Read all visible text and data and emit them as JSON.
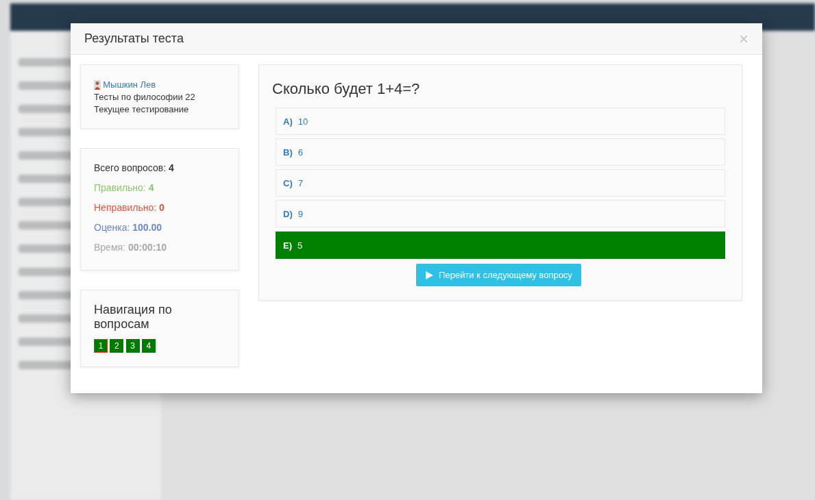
{
  "modal": {
    "title": "Результаты теста",
    "close": "×"
  },
  "student": {
    "name": "Мышкин Лев",
    "test": "Тесты по философии 22",
    "mode": "Текущее тестирование"
  },
  "stats": [
    {
      "kind": "total",
      "label": "Всего вопросов:",
      "value": "4"
    },
    {
      "kind": "correct",
      "label": "Правильно:",
      "value": "4"
    },
    {
      "kind": "wrong",
      "label": "Неправильно:",
      "value": "0"
    },
    {
      "kind": "score",
      "label": "Оценка:",
      "value": "100.00"
    },
    {
      "kind": "time",
      "label": "Время:",
      "value": "00:00:10"
    }
  ],
  "navigation": {
    "title": "Навигация по вопросам",
    "questions": [
      {
        "label": "1",
        "selected": true,
        "answered": true
      },
      {
        "label": "2",
        "selected": false,
        "answered": true
      },
      {
        "label": "3",
        "selected": false,
        "answered": true
      },
      {
        "label": "4",
        "selected": false,
        "answered": true
      }
    ]
  },
  "question": {
    "text": "Сколько будет 1+4=?",
    "answers": [
      {
        "letter": "A)",
        "text": "10",
        "correct": false
      },
      {
        "letter": "B)",
        "text": "6",
        "correct": false
      },
      {
        "letter": "C)",
        "text": "7",
        "correct": false
      },
      {
        "letter": "D)",
        "text": "9",
        "correct": false
      },
      {
        "letter": "E)",
        "text": "5",
        "correct": true
      }
    ]
  },
  "next_button": "Перейти к следующему вопросу"
}
